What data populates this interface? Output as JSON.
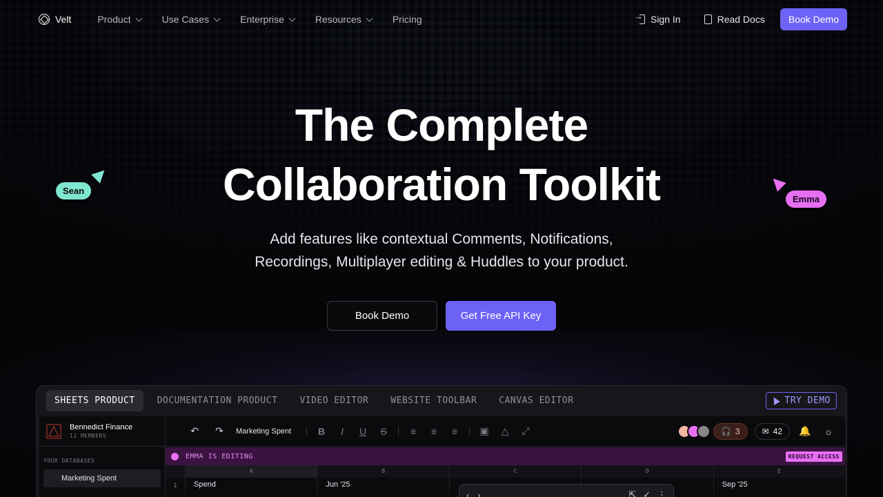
{
  "nav": {
    "brand": "Velt",
    "menu": [
      "Product",
      "Use Cases",
      "Enterprise",
      "Resources",
      "Pricing"
    ],
    "sign_in": "Sign In",
    "read_docs": "Read Docs",
    "book_demo": "Book Demo"
  },
  "hero": {
    "title_line1": "The Complete",
    "title_line2": "Collaboration Toolkit",
    "subtitle_line1": "Add features like contextual Comments, Notifications,",
    "subtitle_line2": "Recordings, Multiplayer editing & Huddles to your product.",
    "btn_book_demo": "Book Demo",
    "btn_api_key": "Get Free API Key"
  },
  "cursors": {
    "left_name": "Sean",
    "right_name": "Emma",
    "left_color": "#7fe6d1",
    "right_color": "#e76ff2"
  },
  "demo": {
    "tabs": [
      "SHEETS PRODUCT",
      "DOCUMENTATION PRODUCT",
      "VIDEO EDITOR",
      "WEBSITE TOOLBAR",
      "CANVAS EDITOR"
    ],
    "try_demo": "TRY DEMO",
    "workspace_name": "Bennedict Finance",
    "workspace_members": "12 MEMBERS",
    "databases_label": "YOUR DATABASES",
    "database_item": "Marketing Spent",
    "doc_title": "Marketing Spent",
    "huddle_count": "3",
    "inbox_count": "42",
    "editing_text": "EMMA IS EDITING",
    "request_access": "REQUEST ACCESS",
    "columns": [
      "A",
      "B",
      "C",
      "D",
      "E"
    ],
    "row1": {
      "num": "1",
      "a": "Spend",
      "b": "Jun '25",
      "e": "Sep '25"
    }
  },
  "colors": {
    "accent": "#6c63f6",
    "emma": "#e76ff2",
    "sean": "#7fe6d1"
  }
}
